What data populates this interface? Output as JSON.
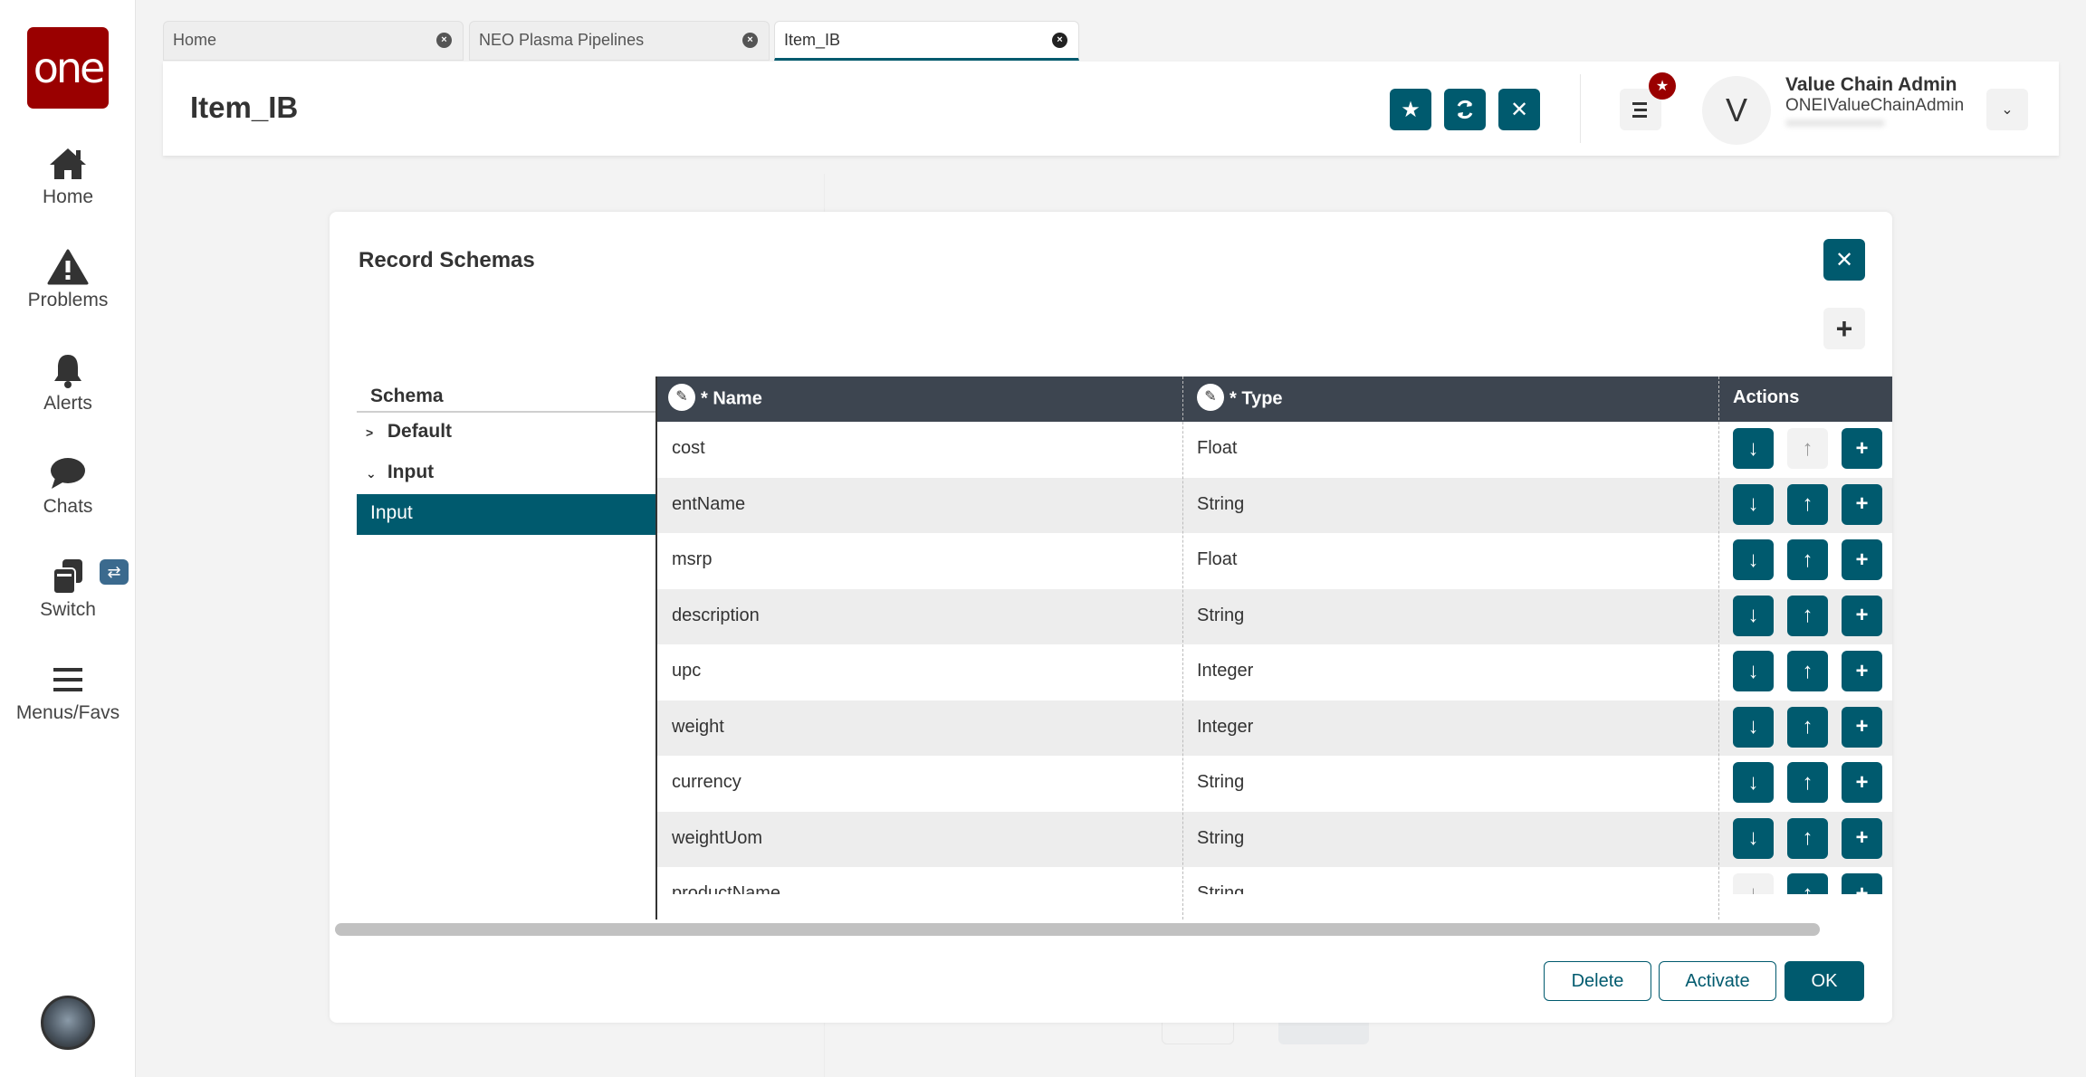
{
  "colors": {
    "accent": "#005a6e",
    "brand_red": "#9a0000",
    "grid_header": "#3d4550",
    "switch_badge": "#3b6a8e"
  },
  "sidebar": {
    "logo": "one",
    "items": [
      {
        "label": "Home",
        "icon": "home-icon"
      },
      {
        "label": "Problems",
        "icon": "warning-icon"
      },
      {
        "label": "Alerts",
        "icon": "bell-icon"
      },
      {
        "label": "Chats",
        "icon": "chat-icon"
      },
      {
        "label": "Switch",
        "icon": "switch-icon"
      },
      {
        "label": "Menus/Favs",
        "icon": "hamburger-icon"
      }
    ],
    "switch_badge_icon": "⇄"
  },
  "tabs": [
    {
      "label": "Home",
      "active": false
    },
    {
      "label": "NEO Plasma Pipelines",
      "active": false
    },
    {
      "label": "Item_IB",
      "active": true
    }
  ],
  "header": {
    "title": "Item_IB",
    "user": {
      "initial": "V",
      "name": "Value Chain Admin",
      "id": "ONEIValueChainAdmin"
    }
  },
  "modal": {
    "title": "Record Schemas",
    "tree": {
      "header": "Schema",
      "nodes": [
        {
          "label": "Default",
          "expanded": false
        },
        {
          "label": "Input",
          "expanded": true,
          "children": [
            {
              "label": "Input",
              "selected": true
            }
          ]
        }
      ]
    },
    "grid": {
      "columns": [
        {
          "label": "* Name",
          "editable": true
        },
        {
          "label": "* Type",
          "editable": true
        },
        {
          "label": "Actions",
          "editable": false
        }
      ],
      "rows": [
        {
          "name": "cost",
          "type": "Float",
          "down_enabled": true,
          "up_enabled": false
        },
        {
          "name": "entName",
          "type": "String",
          "down_enabled": true,
          "up_enabled": true
        },
        {
          "name": "msrp",
          "type": "Float",
          "down_enabled": true,
          "up_enabled": true
        },
        {
          "name": "description",
          "type": "String",
          "down_enabled": true,
          "up_enabled": true
        },
        {
          "name": "upc",
          "type": "Integer",
          "down_enabled": true,
          "up_enabled": true
        },
        {
          "name": "weight",
          "type": "Integer",
          "down_enabled": true,
          "up_enabled": true
        },
        {
          "name": "currency",
          "type": "String",
          "down_enabled": true,
          "up_enabled": true
        },
        {
          "name": "weightUom",
          "type": "String",
          "down_enabled": true,
          "up_enabled": true
        },
        {
          "name": "productName",
          "type": "String",
          "down_enabled": false,
          "up_enabled": true
        }
      ]
    },
    "footer": {
      "delete_label": "Delete",
      "activate_label": "Activate",
      "ok_label": "OK"
    }
  }
}
